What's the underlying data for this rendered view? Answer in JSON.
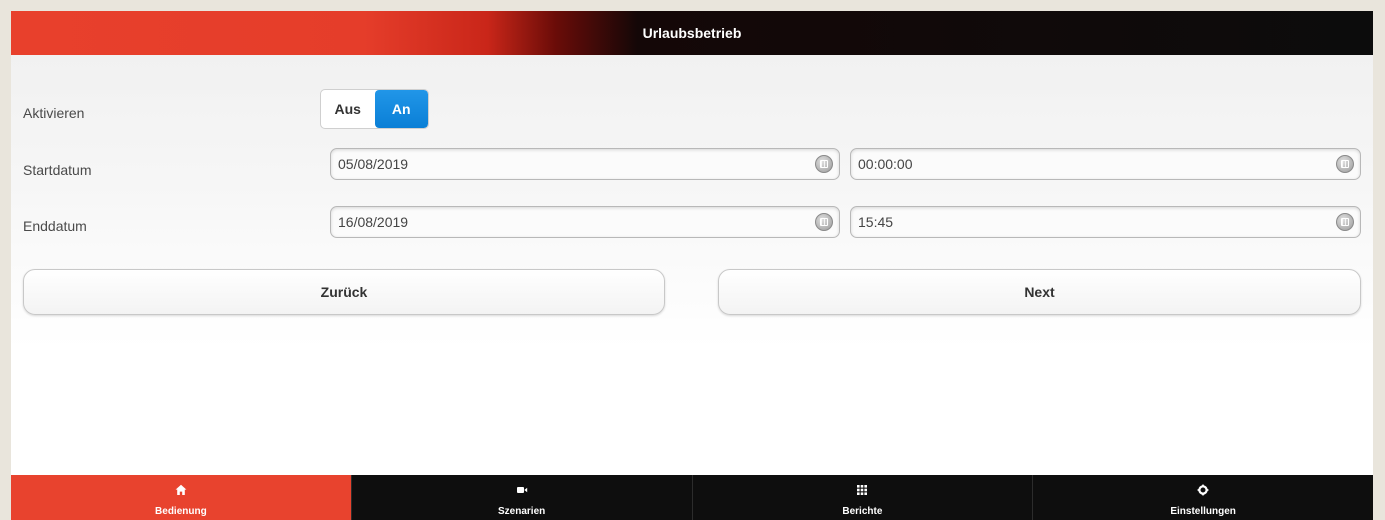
{
  "header": {
    "title": "Urlaubsbetrieb"
  },
  "form": {
    "activate_label": "Aktivieren",
    "toggle": {
      "off_label": "Aus",
      "on_label": "An",
      "selected": "An"
    },
    "start_label": "Startdatum",
    "start_date": "05/08/2019",
    "start_time": "00:00:00",
    "end_label": "Enddatum",
    "end_date": "16/08/2019",
    "end_time": "15:45"
  },
  "actions": {
    "back_label": "Zurück",
    "next_label": "Next"
  },
  "tabs": [
    {
      "label": "Bedienung",
      "icon": "home-icon",
      "active": true
    },
    {
      "label": "Szenarien",
      "icon": "video-camera-icon",
      "active": false
    },
    {
      "label": "Berichte",
      "icon": "grid-icon",
      "active": false
    },
    {
      "label": "Einstellungen",
      "icon": "gear-icon",
      "active": false
    }
  ],
  "colors": {
    "accent_red": "#e8432e",
    "toggle_blue": "#0a7fd6",
    "tabbar_bg": "#0e0e0e"
  }
}
